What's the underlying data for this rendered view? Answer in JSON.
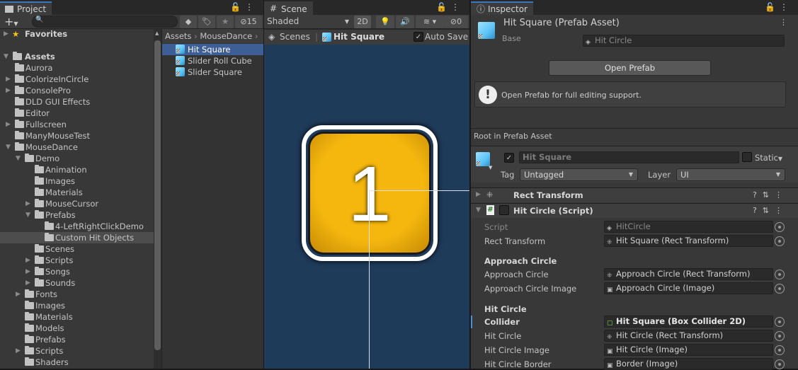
{
  "project": {
    "tab": "Project",
    "hidden_count": "15",
    "search_placeholder": "",
    "favorites": "Favorites",
    "assets": "Assets",
    "tree": [
      {
        "label": "Aurora",
        "level": 1,
        "arrow": "none"
      },
      {
        "label": "ColorizeInCircle",
        "level": 1,
        "arrow": "closed"
      },
      {
        "label": "ConsolePro",
        "level": 1,
        "arrow": "closed"
      },
      {
        "label": "DLD GUI Effects",
        "level": 1,
        "arrow": "none"
      },
      {
        "label": "Editor",
        "level": 1,
        "arrow": "none"
      },
      {
        "label": "Fullscreen",
        "level": 1,
        "arrow": "closed"
      },
      {
        "label": "ManyMouseTest",
        "level": 1,
        "arrow": "none"
      },
      {
        "label": "MouseDance",
        "level": 1,
        "arrow": "open"
      },
      {
        "label": "Demo",
        "level": 2,
        "arrow": "open"
      },
      {
        "label": "Animation",
        "level": 3,
        "arrow": "none"
      },
      {
        "label": "Images",
        "level": 3,
        "arrow": "none"
      },
      {
        "label": "Materials",
        "level": 3,
        "arrow": "none"
      },
      {
        "label": "MouseCursor",
        "level": 3,
        "arrow": "closed"
      },
      {
        "label": "Prefabs",
        "level": 3,
        "arrow": "open"
      },
      {
        "label": "4-LeftRightClickDemo",
        "level": 4,
        "arrow": "none"
      },
      {
        "label": "Custom Hit Objects",
        "level": 4,
        "arrow": "none",
        "selected": true
      },
      {
        "label": "Scenes",
        "level": 3,
        "arrow": "none"
      },
      {
        "label": "Scripts",
        "level": 3,
        "arrow": "closed"
      },
      {
        "label": "Songs",
        "level": 3,
        "arrow": "closed"
      },
      {
        "label": "Sounds",
        "level": 3,
        "arrow": "closed"
      },
      {
        "label": "Fonts",
        "level": 2,
        "arrow": "closed"
      },
      {
        "label": "Images",
        "level": 2,
        "arrow": "none"
      },
      {
        "label": "Materials",
        "level": 2,
        "arrow": "none"
      },
      {
        "label": "Models",
        "level": 2,
        "arrow": "none"
      },
      {
        "label": "Prefabs",
        "level": 2,
        "arrow": "none"
      },
      {
        "label": "Scripts",
        "level": 2,
        "arrow": "closed"
      },
      {
        "label": "Shaders",
        "level": 2,
        "arrow": "none"
      }
    ],
    "breadcrumb": [
      "Assets",
      "MouseDance"
    ],
    "files": [
      {
        "label": "Hit Square",
        "selected": true
      },
      {
        "label": "Slider Roll Cube"
      },
      {
        "label": "Slider Square"
      }
    ]
  },
  "scene": {
    "tab": "Scene",
    "shading": "Shaded",
    "mode_2d": "2D",
    "hidden_count": "0",
    "scenes_label": "Scenes",
    "prefab_name": "Hit Square",
    "auto_save": "Auto Save",
    "auto_save_checked": true,
    "number": "1",
    "bg_color": "#1f3b5a",
    "square_color": "#f5b70e"
  },
  "inspector": {
    "tab": "Inspector",
    "title": "Hit Square (Prefab Asset)",
    "base_label": "Base",
    "base_value": "Hit Circle",
    "open_prefab": "Open Prefab",
    "info": "Open Prefab for full editing support.",
    "root_label": "Root in Prefab Asset",
    "object_name": "Hit Square",
    "static_label": "Static",
    "tag_label": "Tag",
    "tag_value": "Untagged",
    "layer_label": "Layer",
    "layer_value": "UI",
    "components": [
      "Rect Transform",
      "Hit Circle (Script)"
    ],
    "props": {
      "script_label": "Script",
      "script_value": "HitCircle",
      "rect_label": "Rect Transform",
      "rect_value": "Hit Square (Rect Transform)",
      "approach_header": "Approach Circle",
      "approach_label": "Approach Circle",
      "approach_value": "Approach Circle (Rect Transform)",
      "approach_img_label": "Approach Circle Image",
      "approach_img_value": "Approach Circle (Image)",
      "hit_header": "Hit Circle",
      "collider_label": "Collider",
      "collider_value": "Hit Square (Box Collider 2D)",
      "hc_label": "Hit Circle",
      "hc_value": "Hit Circle (Rect Transform)",
      "hci_label": "Hit Circle Image",
      "hci_value": "Hit Circle (Image)",
      "hcb_label": "Hit Circle Border",
      "hcb_value": "Border (Image)"
    }
  }
}
